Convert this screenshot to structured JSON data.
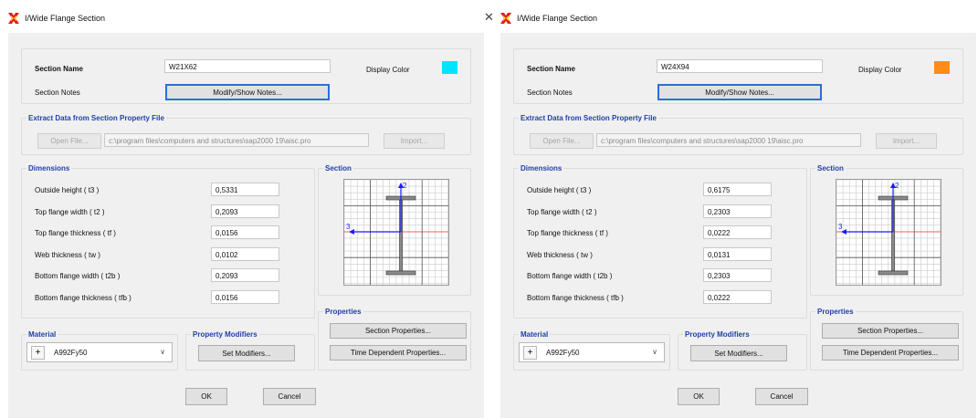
{
  "dialogs": [
    {
      "title": "I/Wide Flange Section",
      "close_glyph": "",
      "section_name_label": "Section Name",
      "section_name_value": "W21X62",
      "display_color_label": "Display Color",
      "display_color": "#00e5ff",
      "section_notes_label": "Section Notes",
      "modify_notes_button": "Modify/Show Notes...",
      "extract_group_title": "Extract Data from Section Property File",
      "open_file_button": "Open File...",
      "file_path": "c:\\program files\\computers and structures\\sap2000 19\\aisc.pro",
      "import_button": "Import...",
      "dimensions_title": "Dimensions",
      "dimensions": [
        {
          "label": "Outside height  ( t3 )",
          "value": "0,5331"
        },
        {
          "label": "Top flange width  ( t2 )",
          "value": "0,2093"
        },
        {
          "label": "Top flange thickness  ( tf )",
          "value": "0,0156"
        },
        {
          "label": "Web thickness  ( tw )",
          "value": "0,0102"
        },
        {
          "label": "Bottom flange width  ( t2b )",
          "value": "0,2093"
        },
        {
          "label": "Bottom flange thickness  ( tfb )",
          "value": "0,0156"
        }
      ],
      "section_title": "Section",
      "axis_2": "2",
      "axis_3": "3",
      "properties_title": "Properties",
      "section_properties_button": "Section Properties...",
      "time_dependent_button": "Time Dependent Properties...",
      "material_title": "Material",
      "material_plus": "+",
      "material_value": "A992Fy50",
      "property_modifiers_title": "Property Modifiers",
      "set_modifiers_button": "Set Modifiers...",
      "ok_button": "OK",
      "cancel_button": "Cancel"
    },
    {
      "title": "I/Wide Flange Section",
      "close_glyph": "✕",
      "section_name_label": "Section Name",
      "section_name_value": "W24X94",
      "display_color_label": "Display Color",
      "display_color": "#ff8c1a",
      "section_notes_label": "Section Notes",
      "modify_notes_button": "Modify/Show Notes...",
      "extract_group_title": "Extract Data from Section Property File",
      "open_file_button": "Open File...",
      "file_path": "c:\\program files\\computers and structures\\sap2000 19\\aisc.pro",
      "import_button": "Import...",
      "dimensions_title": "Dimensions",
      "dimensions": [
        {
          "label": "Outside height  ( t3 )",
          "value": "0,6175"
        },
        {
          "label": "Top flange width  ( t2 )",
          "value": "0,2303"
        },
        {
          "label": "Top flange thickness  ( tf )",
          "value": "0,0222"
        },
        {
          "label": "Web thickness  ( tw )",
          "value": "0,0131"
        },
        {
          "label": "Bottom flange width  ( t2b )",
          "value": "0,2303"
        },
        {
          "label": "Bottom flange thickness  ( tfb )",
          "value": "0,0222"
        }
      ],
      "section_title": "Section",
      "axis_2": "2",
      "axis_3": "3",
      "properties_title": "Properties",
      "section_properties_button": "Section Properties...",
      "time_dependent_button": "Time Dependent Properties...",
      "material_title": "Material",
      "material_plus": "+",
      "material_value": "A992Fy50",
      "property_modifiers_title": "Property Modifiers",
      "set_modifiers_button": "Set Modifiers...",
      "ok_button": "OK",
      "cancel_button": "Cancel"
    }
  ],
  "colors": {
    "group_title": "#1f3fa8",
    "axis_2": "#1a1aff",
    "axis_3": "#ff3333",
    "default_button_border": "#2b6fd6"
  },
  "icons": {
    "app_icon": "sap2000-x-icon",
    "material_dropdown": "chevron-down-icon"
  }
}
